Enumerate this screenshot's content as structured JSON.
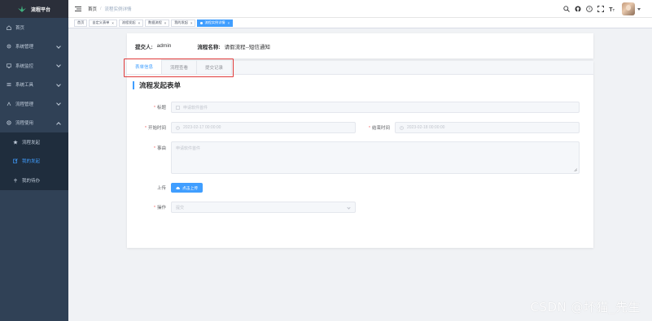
{
  "app": {
    "title": "流程平台"
  },
  "sidebar": {
    "items": [
      {
        "label": "首页",
        "icon": "home-icon"
      },
      {
        "label": "系统管理",
        "icon": "gear-icon"
      },
      {
        "label": "系统监控",
        "icon": "monitor-icon"
      },
      {
        "label": "系统工具",
        "icon": "tools-icon"
      },
      {
        "label": "流程管理",
        "icon": "flow-icon"
      },
      {
        "label": "流程使用",
        "icon": "cog-icon"
      }
    ],
    "submenu": [
      {
        "label": "流程发起",
        "icon": "star-icon"
      },
      {
        "label": "我的发起",
        "icon": "edit-icon"
      },
      {
        "label": "我的待办",
        "icon": "pin-icon"
      }
    ]
  },
  "navbar": {
    "breadcrumb": [
      "首页",
      "流程实例详情"
    ]
  },
  "tags": [
    {
      "label": "首页"
    },
    {
      "label": "自定义表单"
    },
    {
      "label": "流程发起"
    },
    {
      "label": "数据流程"
    },
    {
      "label": "我的发起"
    },
    {
      "label": "流程实例详情"
    }
  ],
  "info": {
    "submitter_label": "提交人:",
    "submitter_value": "admin",
    "process_label": "流程名称:",
    "process_value": "请假流程--短信通知"
  },
  "tabs": [
    "表单信息",
    "流程查看",
    "提交记录"
  ],
  "form": {
    "title": "流程发起表单",
    "title_field": {
      "label": "标题",
      "placeholder": "申请软件首件"
    },
    "start_field": {
      "label": "开始时间",
      "value": "2023-02-17 00:00:00"
    },
    "end_field": {
      "label": "结束时间",
      "value": "2023-02-18 00:00:00"
    },
    "reason_field": {
      "label": "事由",
      "placeholder": "申请软件首件"
    },
    "upload_field": {
      "label": "上传",
      "button": "点击上传"
    },
    "action_field": {
      "label": "操作",
      "value": "提交"
    }
  },
  "watermark": "CSDN @坏猫_先生",
  "colors": {
    "primary": "#409eff",
    "sidebar": "#304156",
    "highlight": "#e03a3a"
  }
}
